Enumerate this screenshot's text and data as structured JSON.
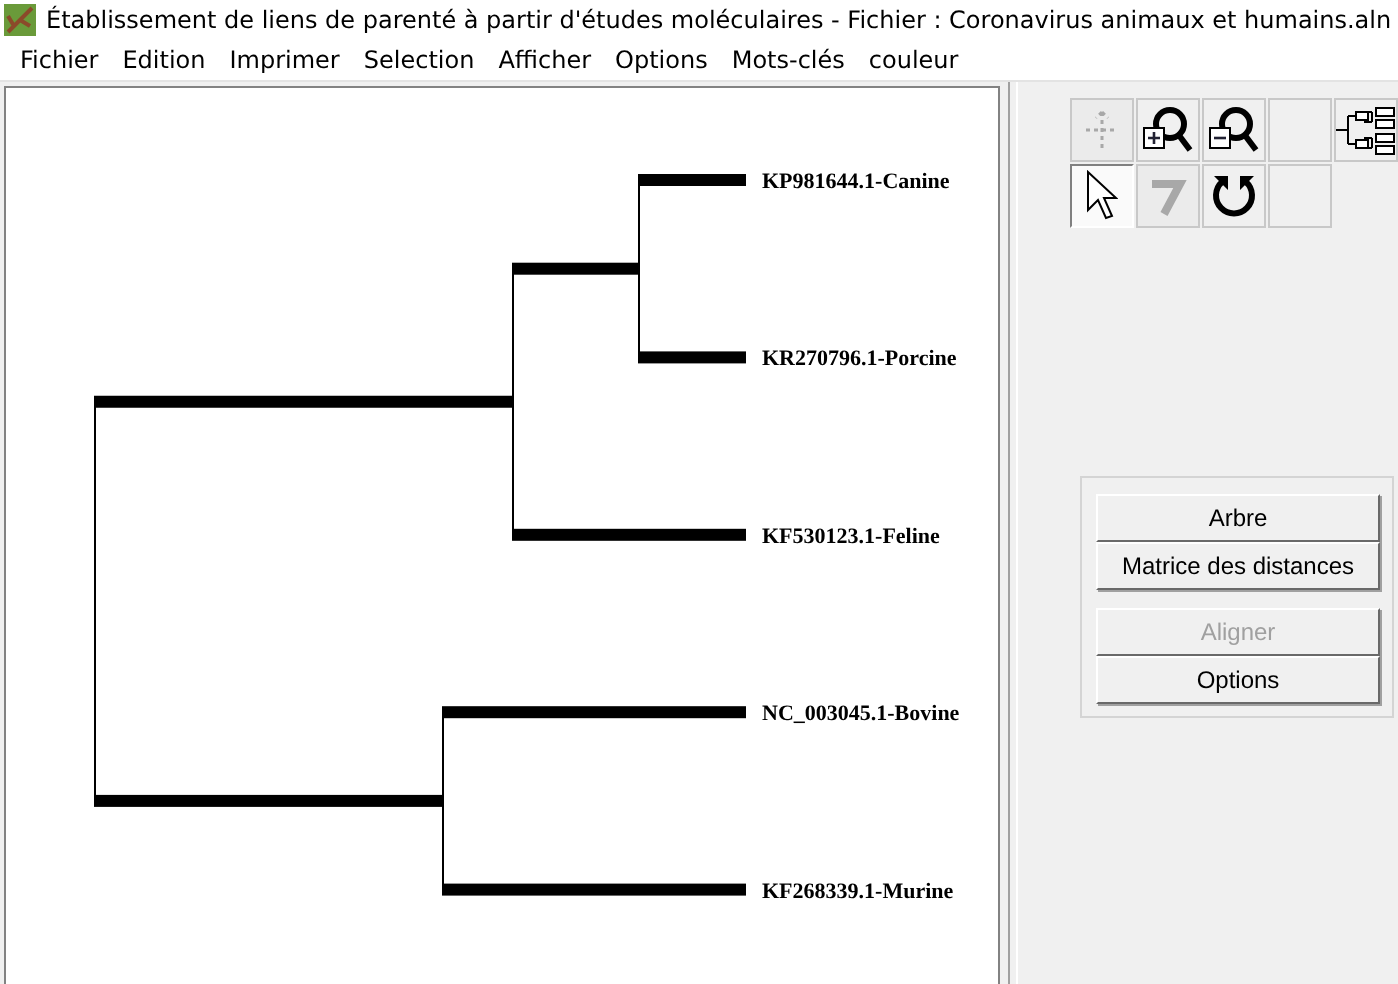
{
  "window": {
    "title": "Établissement de liens de parenté à partir d'études moléculaires - Fichier : Coronavirus animaux et humains.aln"
  },
  "menu": [
    "Fichier",
    "Edition",
    "Imprimer",
    "Selection",
    "Afficher",
    "Options",
    "Mots-clés",
    "couleur"
  ],
  "tree": {
    "children": [
      {
        "children": [
          {
            "children": [
              {
                "label": "KP981644.1-Canine"
              },
              {
                "label": "KR270796.1-Porcine"
              }
            ]
          },
          {
            "label": "KF530123.1-Feline"
          }
        ]
      },
      {
        "children": [
          {
            "label": "NC_003045.1-Bovine"
          },
          {
            "label": "KF268339.1-Murine"
          }
        ]
      }
    ]
  },
  "tools": [
    {
      "kind": "move",
      "disabled": true,
      "selected": false
    },
    {
      "kind": "zoom-in",
      "disabled": false,
      "selected": false
    },
    {
      "kind": "zoom-out",
      "disabled": false,
      "selected": false
    },
    {
      "kind": "empty",
      "selected": false
    },
    {
      "kind": "tree",
      "disabled": false,
      "selected": false
    },
    {
      "kind": "pointer",
      "disabled": false,
      "selected": true
    },
    {
      "kind": "hook",
      "disabled": true,
      "selected": false
    },
    {
      "kind": "rotate",
      "disabled": false,
      "selected": false
    },
    {
      "kind": "empty",
      "selected": false
    }
  ],
  "buttons": [
    [
      {
        "label": "Arbre",
        "disabled": false
      },
      {
        "label": "Matrice des distances",
        "disabled": false
      }
    ],
    [
      {
        "label": "Aligner",
        "disabled": true
      },
      {
        "label": "Options",
        "disabled": false
      }
    ]
  ]
}
